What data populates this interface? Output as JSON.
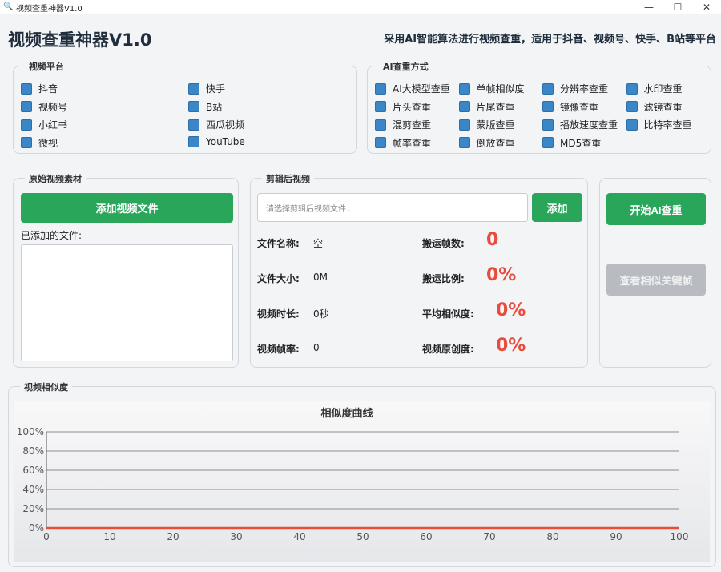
{
  "window": {
    "title": "视频查重神器V1.0",
    "icon": "magnifier-icon",
    "controls": [
      "minimize-icon",
      "maximize-icon",
      "close-icon"
    ]
  },
  "header": {
    "title": "视频查重神器V1.0",
    "subtitle": "采用AI智能算法进行视频查重，适用于抖音、视频号、快手、B站等平台"
  },
  "platforms": {
    "title": "视频平台",
    "items": [
      "抖音",
      "快手",
      "视频号",
      "B站",
      "小红书",
      "西瓜视频",
      "微视",
      "YouTube"
    ]
  },
  "methods": {
    "title": "AI查重方式",
    "items": [
      "AI大模型查重",
      "单帧相似度",
      "分辨率查重",
      "水印查重",
      "片头查重",
      "片尾查重",
      "镜像查重",
      "滤镜查重",
      "混剪查重",
      "蒙版查重",
      "播放速度查重",
      "比特率查重",
      "帧率查重",
      "倒放查重",
      "MD5查重"
    ]
  },
  "original": {
    "title": "原始视频素材",
    "add_button": "添加视频文件",
    "added_label": "已添加的文件:"
  },
  "edited": {
    "title": "剪辑后视频",
    "input_placeholder": "请选择剪辑后视频文件...",
    "add_button": "添加",
    "file_name_label": "文件名称:",
    "file_name_value": "空",
    "file_size_label": "文件大小:",
    "file_size_value": "0M",
    "duration_label": "视频时长:",
    "duration_value": "0秒",
    "fps_label": "视频帧率:",
    "fps_value": "0",
    "moved_frames_label": "搬运帧数:",
    "moved_frames_value": "0",
    "moved_ratio_label": "搬运比例:",
    "moved_ratio_value": "0%",
    "avg_similarity_label": "平均相似度:",
    "avg_similarity_value": "0%",
    "originality_label": "视频原创度:",
    "originality_value": "0%"
  },
  "actions": {
    "start_button": "开始AI查重",
    "keyframes_button": "查看相似关键帧"
  },
  "similarity": {
    "title": "视频相似度"
  },
  "chart_data": {
    "type": "line",
    "title": "相似度曲线",
    "xlabel": "",
    "ylabel": "",
    "x_ticks": [
      "0",
      "10",
      "20",
      "30",
      "40",
      "50",
      "60",
      "70",
      "80",
      "90",
      "100"
    ],
    "y_ticks": [
      "0%",
      "20%",
      "40%",
      "60%",
      "80%",
      "100%"
    ],
    "xlim": [
      0,
      100
    ],
    "ylim": [
      0,
      100
    ],
    "grid": true,
    "line_color": "#e74c3c",
    "x": [
      0,
      10,
      20,
      30,
      40,
      50,
      60,
      70,
      80,
      90,
      100
    ],
    "y": [
      0,
      0,
      0,
      0,
      0,
      0,
      0,
      0,
      0,
      0,
      0
    ]
  }
}
